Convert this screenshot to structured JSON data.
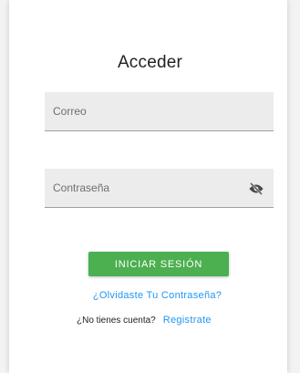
{
  "login": {
    "title": "Acceder",
    "email_placeholder": "Correo",
    "email_value": "",
    "password_placeholder": "Contraseña",
    "password_value": "",
    "password_toggle_icon": "eye-off-icon",
    "submit_label": "INICIAR SESIÓN",
    "forgot_label": "¿Olvidaste Tu Contraseña?",
    "no_account_text": "¿No tienes cuenta?",
    "register_label": "Registrate"
  },
  "colors": {
    "primary_button": "#4caf50",
    "link": "#2196f3",
    "field_background": "#ececec"
  }
}
